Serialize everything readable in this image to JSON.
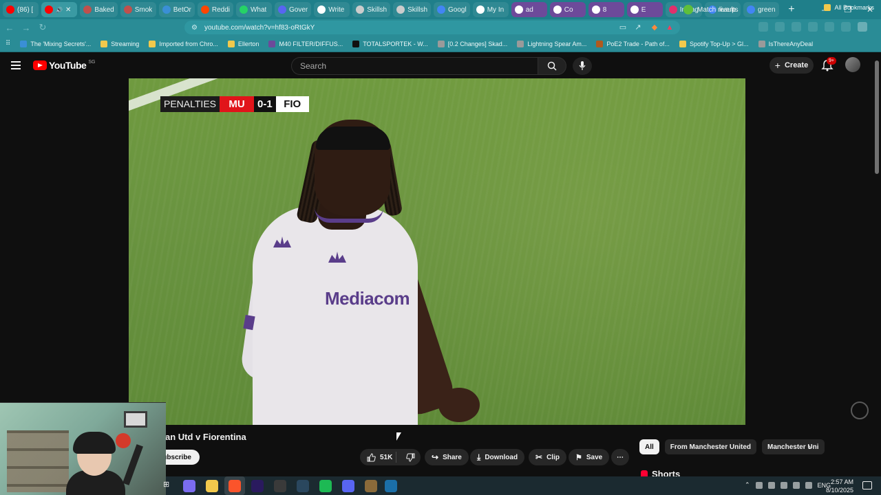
{
  "browser": {
    "tabs": [
      {
        "label": "(86) [",
        "icon_color": "#ff0000",
        "state": "normal"
      },
      {
        "label": "",
        "icon_color": "#ff0000",
        "state": "active",
        "has_audio": true
      },
      {
        "label": "Baked",
        "icon_color": "#c0504d",
        "state": "normal"
      },
      {
        "label": "Smok",
        "icon_color": "#c0504d",
        "state": "normal"
      },
      {
        "label": "BetOr",
        "icon_color": "#3a8fd6",
        "state": "normal"
      },
      {
        "label": "Reddi",
        "icon_color": "#ff4500",
        "state": "normal"
      },
      {
        "label": "What",
        "icon_color": "#25d366",
        "state": "normal"
      },
      {
        "label": "Gover",
        "icon_color": "#5865f2",
        "state": "normal"
      },
      {
        "label": "Write",
        "icon_color": "#ffffff",
        "state": "normal"
      },
      {
        "label": "Skillsh",
        "icon_color": "#cccccc",
        "state": "normal"
      },
      {
        "label": "Skillsh",
        "icon_color": "#cccccc",
        "state": "normal"
      },
      {
        "label": "Googl",
        "icon_color": "#4285f4",
        "state": "normal"
      },
      {
        "label": "My In",
        "icon_color": "#ffffff",
        "state": "normal"
      },
      {
        "label": "ad",
        "icon_color": "#ffffff",
        "state": "purple"
      },
      {
        "label": "Co",
        "icon_color": "#ffffff",
        "state": "purple"
      },
      {
        "label": "8",
        "icon_color": "#ffffff",
        "state": "purple"
      },
      {
        "label": "E",
        "icon_color": "#ffffff",
        "state": "purple"
      },
      {
        "label": "Instag",
        "icon_color": "#e1306c",
        "state": "normal"
      },
      {
        "label": "liverp",
        "icon_color": "#4285f4",
        "state": "normal"
      },
      {
        "label": "green",
        "icon_color": "#4285f4",
        "state": "normal"
      }
    ],
    "new_tab": "+",
    "window_controls": {
      "minimize": "—",
      "restore": "❐",
      "close": "✕"
    },
    "url": "youtube.com/watch?v=hf83-oRtGkY",
    "bookmarks": [
      {
        "label": "The 'Mixing Secrets'...",
        "icon_color": "#3a8fd6"
      },
      {
        "label": "Streaming",
        "icon_color": "#f2c94c"
      },
      {
        "label": "Imported from Chro...",
        "icon_color": "#f2c94c"
      },
      {
        "label": "Ellerton",
        "icon_color": "#f2c94c"
      },
      {
        "label": "M40 FILTER/DIFFUS...",
        "icon_color": "#6d4a9a"
      },
      {
        "label": "TOTALSPORTEK - W...",
        "icon_color": "#111111"
      },
      {
        "label": "[0.2 Changes] Skad...",
        "icon_color": "#9a9a9a"
      },
      {
        "label": "Lightning Spear Am...",
        "icon_color": "#9a9a9a"
      },
      {
        "label": "PoE2 Trade - Path of...",
        "icon_color": "#b05a1e"
      },
      {
        "label": "Spotify Top-Up > Gl...",
        "icon_color": "#f2c94c"
      },
      {
        "label": "IsThereAnyDeal",
        "icon_color": "#9a9a9a"
      }
    ],
    "all_bookmarks": "All Bookmarks"
  },
  "youtube": {
    "logo_text": "YouTube",
    "country_code": "SG",
    "search_placeholder": "Search",
    "create_label": "Create",
    "notification_count": "9+",
    "video_title": "an Utd v Fiorentina",
    "subscribe_label": "Subscribe",
    "like_count": "51K",
    "share_label": "Share",
    "download_label": "Download",
    "clip_label": "Clip",
    "save_label": "Save",
    "more_label": "⋯",
    "chips": [
      {
        "label": "All",
        "selected": true
      },
      {
        "label": "From Manchester United",
        "selected": false
      },
      {
        "label": "Manchester Uni",
        "selected": false
      }
    ],
    "shorts_label": "Shorts"
  },
  "video": {
    "scoreboard": {
      "label": "PENALTIES",
      "home": "MU",
      "score": "0-1",
      "away": "FIO"
    },
    "shirt_sponsor": "Mediacom"
  },
  "taskbar": {
    "apps": [
      {
        "name": "copilot",
        "color": "#7b6cf0"
      },
      {
        "name": "file-explorer",
        "color": "#f2c94c"
      },
      {
        "name": "brave",
        "color": "#fb542b"
      },
      {
        "name": "premiere",
        "color": "#2a1a5e"
      },
      {
        "name": "obs",
        "color": "#3a3a3a"
      },
      {
        "name": "steam",
        "color": "#2a475e"
      },
      {
        "name": "spotify",
        "color": "#1db954"
      },
      {
        "name": "discord",
        "color": "#5865f2"
      },
      {
        "name": "game",
        "color": "#8a6a3a"
      },
      {
        "name": "steam-2",
        "color": "#1b6fa8"
      }
    ],
    "widget_label": "Match results",
    "language": "ENG",
    "time": "2:57 AM",
    "date": "8/10/2025"
  }
}
